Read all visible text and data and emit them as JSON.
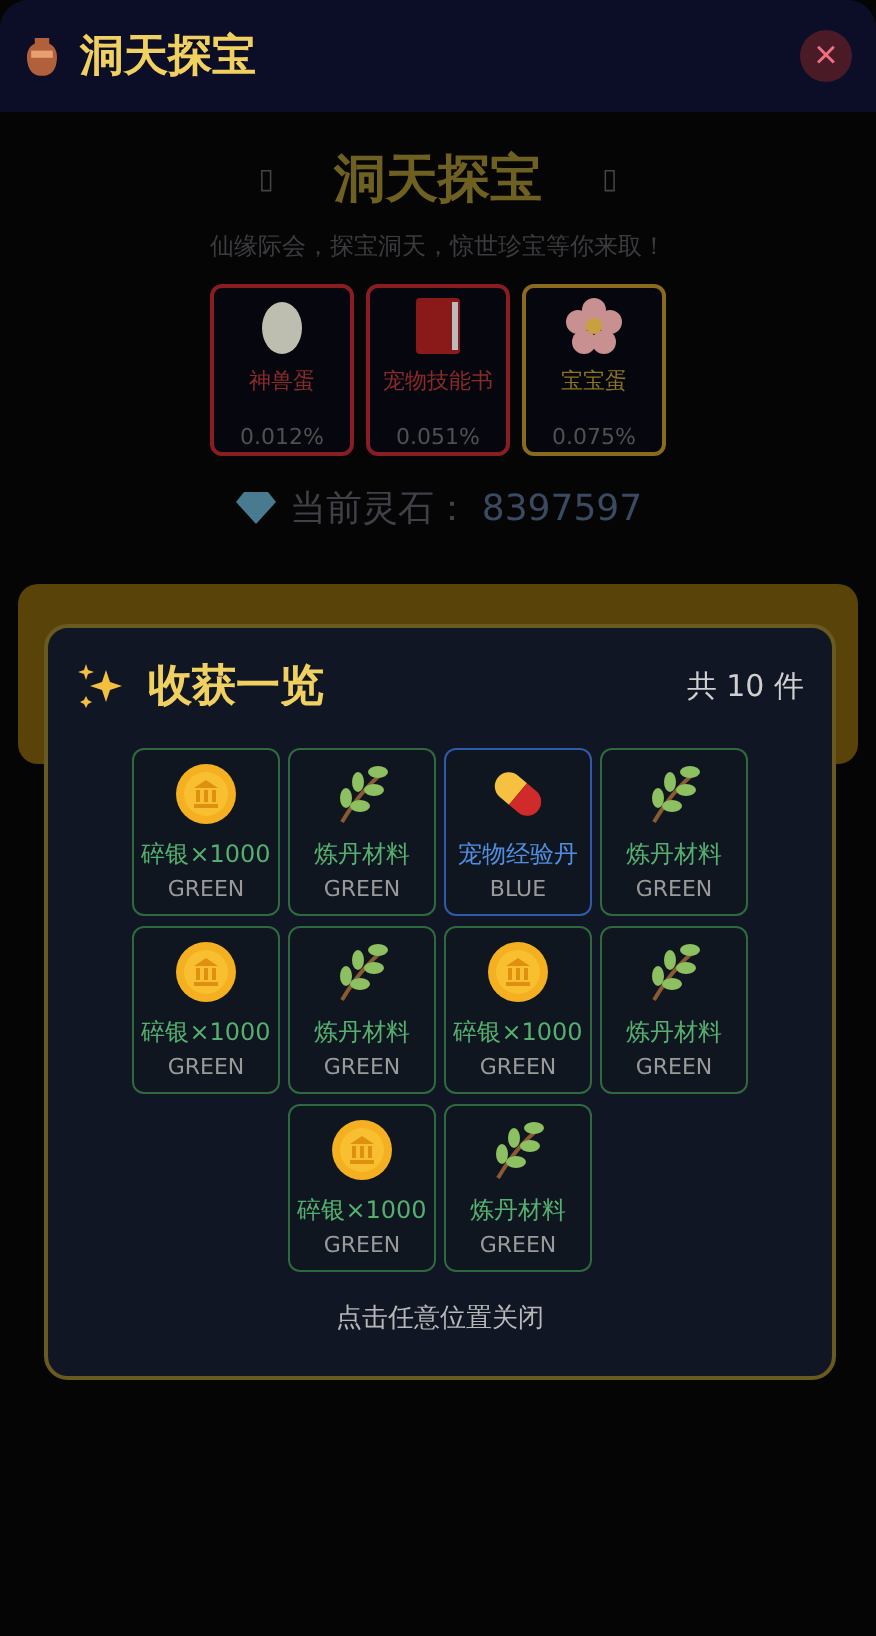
{
  "header": {
    "title": "洞天探宝",
    "close": "×"
  },
  "banner": {
    "title": "洞天探宝",
    "left_mark": "▯",
    "right_mark": "▯",
    "subtitle": "仙缘际会，探宝洞天，惊世珍宝等你来取！"
  },
  "prizes": [
    {
      "kind": "egg",
      "name": "神兽蛋",
      "rate": "0.012%",
      "color": "#8a1c24"
    },
    {
      "kind": "book",
      "name": "宠物技能书",
      "rate": "0.051%",
      "color": "#8a1c24"
    },
    {
      "kind": "flower",
      "name": "宝宝蛋",
      "rate": "0.075%",
      "color": "#8a6a1c"
    }
  ],
  "balance": {
    "label": "当前灵石：",
    "value": "8397597"
  },
  "modal": {
    "title": "收获一览",
    "count": "共 10 件",
    "hint": "点击任意位置关闭",
    "items": [
      {
        "kind": "coin",
        "name": "碎银×1000",
        "rarity": "GREEN",
        "color": "#2f6a3e"
      },
      {
        "kind": "herb",
        "name": "炼丹材料",
        "rarity": "GREEN",
        "color": "#2f6a3e"
      },
      {
        "kind": "pill",
        "name": "宠物经验丹",
        "rarity": "BLUE",
        "color": "#2e5aa8"
      },
      {
        "kind": "herb",
        "name": "炼丹材料",
        "rarity": "GREEN",
        "color": "#2f6a3e"
      },
      {
        "kind": "coin",
        "name": "碎银×1000",
        "rarity": "GREEN",
        "color": "#2f6a3e"
      },
      {
        "kind": "herb",
        "name": "炼丹材料",
        "rarity": "GREEN",
        "color": "#2f6a3e"
      },
      {
        "kind": "coin",
        "name": "碎银×1000",
        "rarity": "GREEN",
        "color": "#2f6a3e"
      },
      {
        "kind": "herb",
        "name": "炼丹材料",
        "rarity": "GREEN",
        "color": "#2f6a3e"
      },
      {
        "kind": "coin",
        "name": "碎银×1000",
        "rarity": "GREEN",
        "color": "#2f6a3e"
      },
      {
        "kind": "herb",
        "name": "炼丹材料",
        "rarity": "GREEN",
        "color": "#2f6a3e"
      }
    ]
  }
}
